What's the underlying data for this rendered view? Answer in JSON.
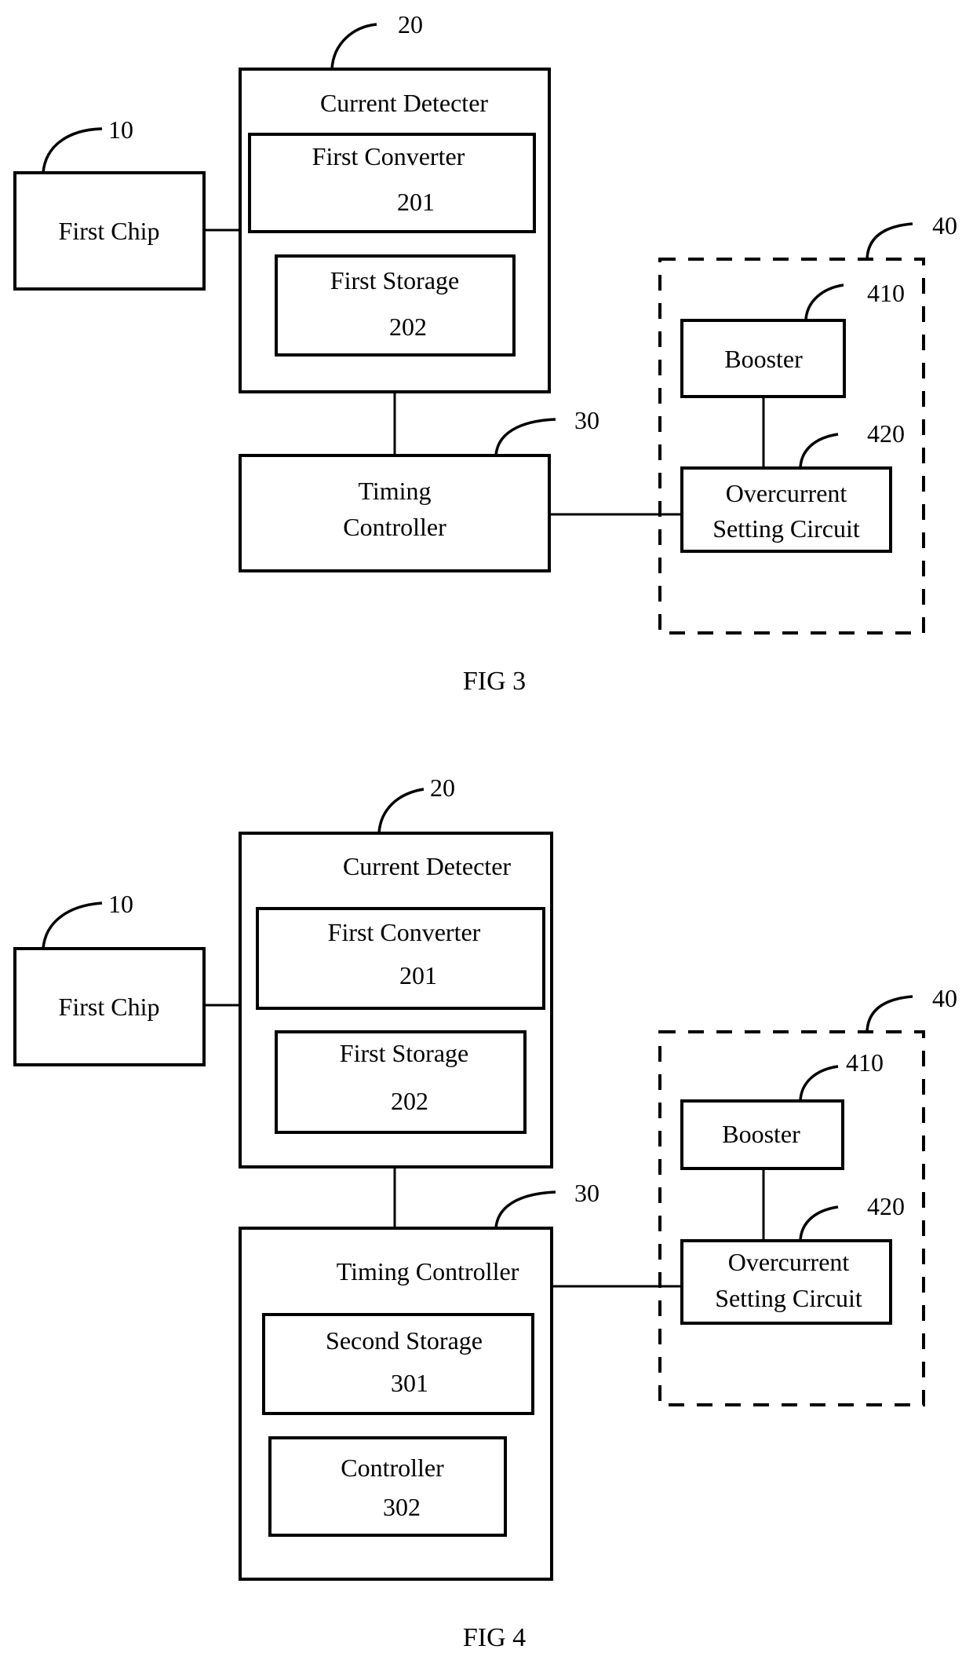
{
  "figures": [
    {
      "caption": "FIG 3",
      "first_chip": {
        "label": "First Chip",
        "ref": "10"
      },
      "current_detector": {
        "label": "Current Detecter",
        "ref": "20",
        "first_converter": {
          "label": "First Converter",
          "ref": "201"
        },
        "first_storage": {
          "label": "First Storage",
          "ref": "202"
        }
      },
      "timing_controller": {
        "label_line1": "Timing",
        "label_line2": "Controller",
        "ref": "30"
      },
      "group": {
        "ref": "40",
        "booster": {
          "label": "Booster",
          "ref": "410"
        },
        "overcurrent": {
          "label_line1": "Overcurrent",
          "label_line2": "Setting Circuit",
          "ref": "420"
        }
      }
    },
    {
      "caption": "FIG 4",
      "first_chip": {
        "label": "First Chip",
        "ref": "10"
      },
      "current_detector": {
        "label": "Current Detecter",
        "ref": "20",
        "first_converter": {
          "label": "First Converter",
          "ref": "201"
        },
        "first_storage": {
          "label": "First Storage",
          "ref": "202"
        }
      },
      "timing_controller": {
        "label": "Timing Controller",
        "ref": "30",
        "second_storage": {
          "label": "Second Storage",
          "ref": "301"
        },
        "controller": {
          "label": "Controller",
          "ref": "302"
        }
      },
      "group": {
        "ref": "40",
        "booster": {
          "label": "Booster",
          "ref": "410"
        },
        "overcurrent": {
          "label_line1": "Overcurrent",
          "label_line2": "Setting Circuit",
          "ref": "420"
        }
      }
    }
  ]
}
